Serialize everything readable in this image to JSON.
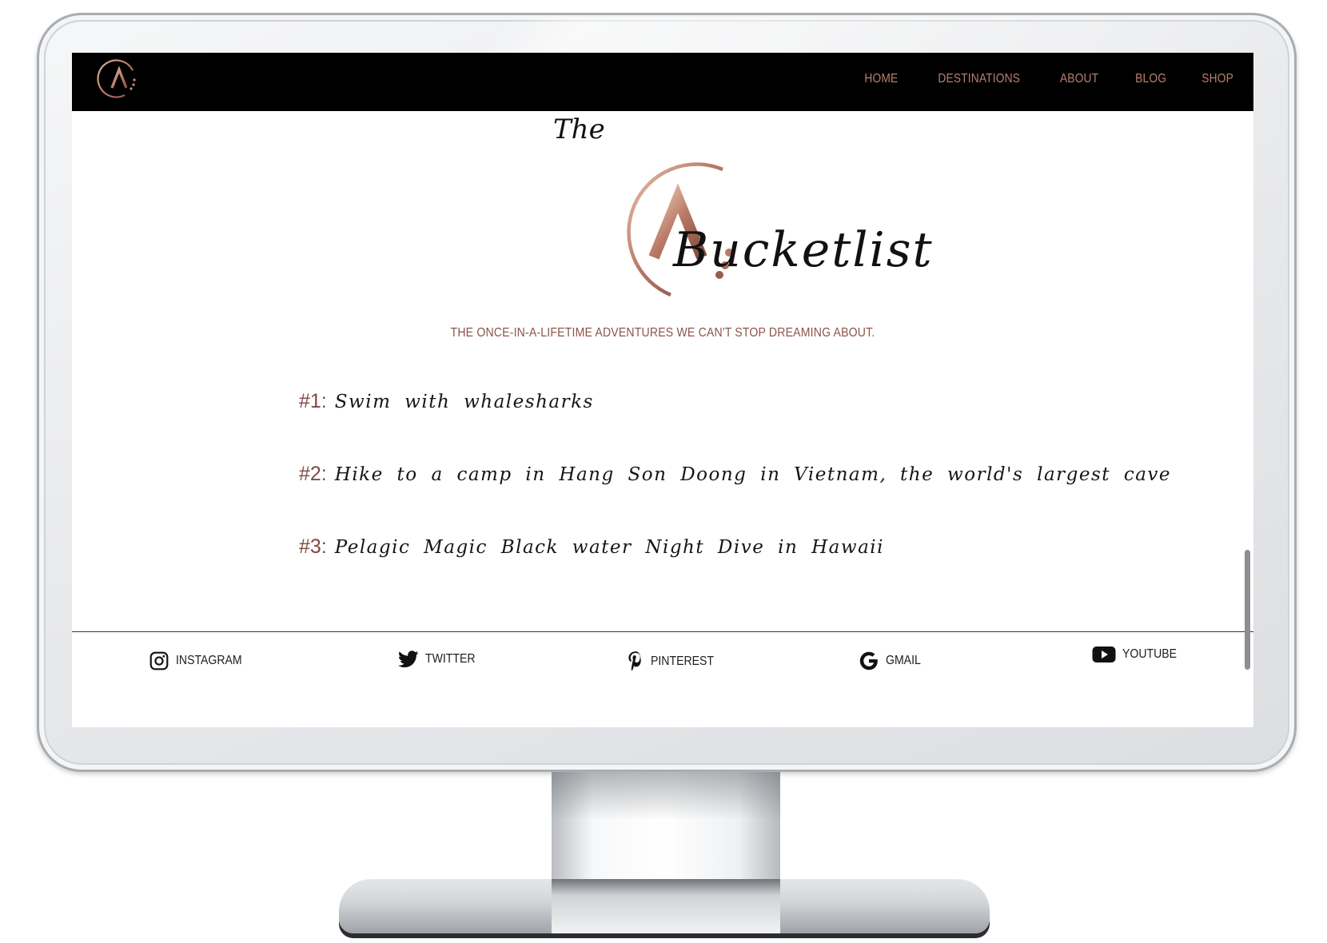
{
  "nav": {
    "items": [
      {
        "label": "HOME"
      },
      {
        "label": "DESTINATIONS"
      },
      {
        "label": "ABOUT"
      },
      {
        "label": "BLOG"
      },
      {
        "label": "SHOP"
      }
    ]
  },
  "hero": {
    "logo_letter": "A",
    "the": "The",
    "bucketlist": "Bucketlist",
    "tagline": "THE ONCE-IN-A-LIFETIME ADVENTURES WE CAN'T STOP DREAMING ABOUT."
  },
  "list": [
    {
      "num": "#1:",
      "text": "Swim with whalesharks"
    },
    {
      "num": "#2:",
      "text": "Hike to a camp in Hang Son Doong in Vietnam, the world's largest cave"
    },
    {
      "num": "#3:",
      "text": "Pelagic Magic Black water Night Dive in Hawaii"
    }
  ],
  "footer": {
    "social": [
      {
        "label": "INSTAGRAM",
        "icon": "instagram-icon"
      },
      {
        "label": "TWITTER",
        "icon": "twitter-icon"
      },
      {
        "label": "PINTEREST",
        "icon": "pinterest-icon"
      },
      {
        "label": "GMAIL",
        "icon": "google-icon"
      },
      {
        "label": "YOUTUBE",
        "icon": "youtube-icon"
      }
    ]
  },
  "colors": {
    "accent": "#b8806e",
    "accent_dark": "#7f4a40",
    "navbar_bg": "#000000"
  }
}
